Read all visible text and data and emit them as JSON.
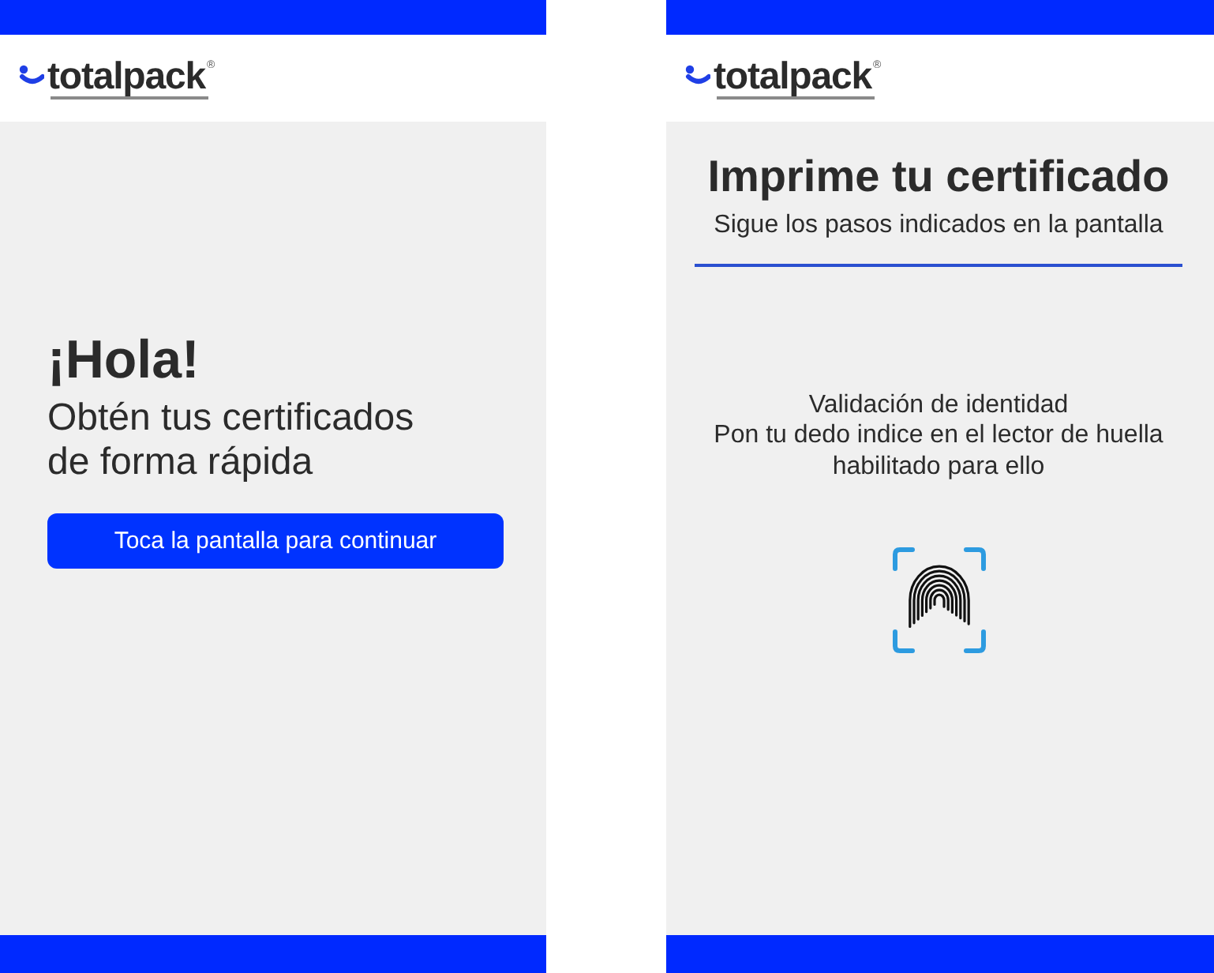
{
  "screens": [
    {
      "kind": "welcome",
      "logo": {
        "wordmark": "totalpack",
        "mark": "®"
      },
      "heading": "¡Hola!",
      "subheading": "Obtén tus certificados de forma rápida",
      "button": "Toca la pantalla para continuar"
    },
    {
      "kind": "fingerprint",
      "logo": {
        "wordmark": "totalpack",
        "mark": "®"
      },
      "title": "Imprime tu certificado",
      "subtitle": "Sigue los pasos indicados en la pantalla",
      "step": "Validación de identidad",
      "instruction": "Pon tu dedo indice en el lector de huella habilitado para ello"
    }
  ]
}
